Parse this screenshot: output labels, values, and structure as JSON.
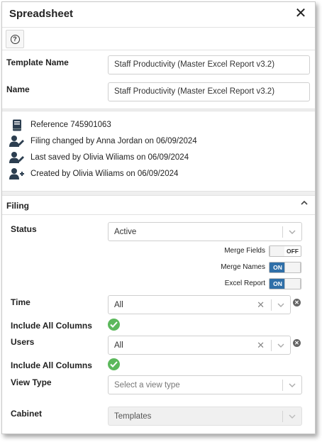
{
  "window": {
    "title": "Spreadsheet",
    "close_icon": "close-icon"
  },
  "toolbar": {
    "help_icon": "help-icon"
  },
  "form": {
    "template_name_label": "Template Name",
    "template_name_value": "Staff Productivity (Master Excel Report v3.2)",
    "name_label": "Name",
    "name_value": "Staff Productivity (Master Excel Report v3.2)"
  },
  "info": [
    {
      "icon": "book-icon",
      "text": "Reference 745901063"
    },
    {
      "icon": "user-edit-icon",
      "text": "Filing changed by Anna Jordan on 06/09/2024"
    },
    {
      "icon": "user-edit-icon",
      "text": "Last saved by Olivia Wiliams on 06/09/2024"
    },
    {
      "icon": "user-add-icon",
      "text": "Created by Olivia Wiliams on 06/09/2024"
    }
  ],
  "filing": {
    "title": "Filing",
    "status_label": "Status",
    "status_value": "Active",
    "toggles": [
      {
        "label": "Merge Fields",
        "state": "OFF"
      },
      {
        "label": "Merge Names",
        "state": "ON"
      },
      {
        "label": "Excel Report",
        "state": "ON"
      }
    ],
    "time_label": "Time",
    "time_value": "All",
    "include_all_columns_label_1": "Include All Columns",
    "users_label": "Users",
    "users_value": "All",
    "include_all_columns_label_2": "Include All Columns",
    "view_type_label": "View Type",
    "view_type_placeholder": "Select a view type",
    "cabinet_label": "Cabinet",
    "cabinet_value": "Templates"
  },
  "colors": {
    "toggle_on": "#2f6fa8",
    "check_green": "#5cb85c"
  }
}
